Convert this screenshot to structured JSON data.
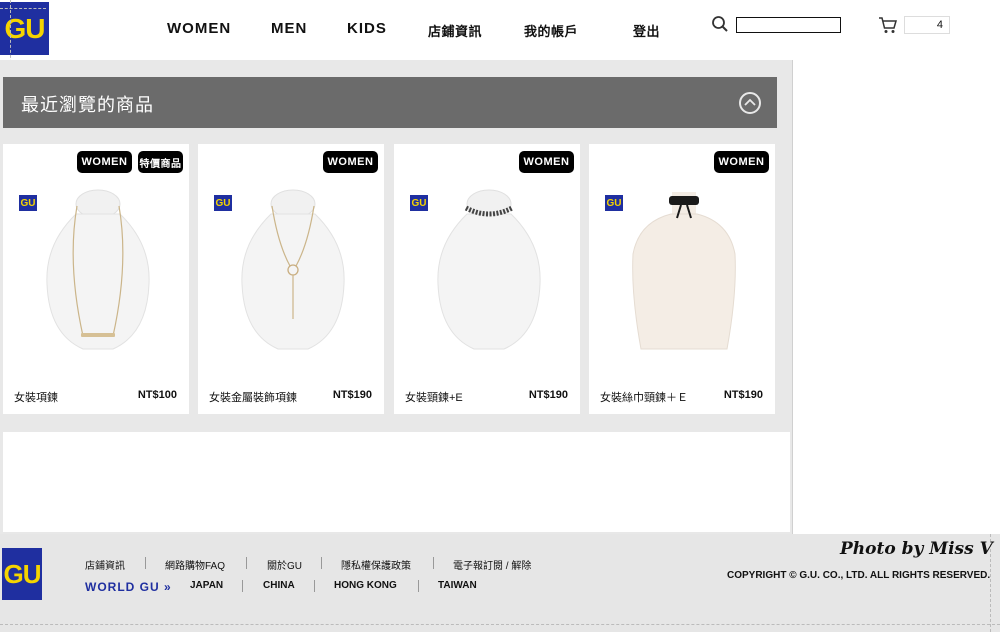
{
  "header": {
    "logo": "GU",
    "nav": [
      "WOMEN",
      "MEN",
      "KIDS",
      "店鋪資訊",
      "我的帳戶",
      "登出"
    ],
    "search": {
      "value": "",
      "placeholder": ""
    },
    "cart_count": "4"
  },
  "recent": {
    "title": "最近瀏覽的商品",
    "products": [
      {
        "badges": [
          "WOMEN",
          "特價商品"
        ],
        "brand": "GU",
        "name": "女裝項鍊",
        "price": "NT$100"
      },
      {
        "badges": [
          "WOMEN"
        ],
        "brand": "GU",
        "name": "女裝金屬裝飾項鍊",
        "price": "NT$190"
      },
      {
        "badges": [
          "WOMEN"
        ],
        "brand": "GU",
        "name": "女裝頸鍊+E",
        "price": "NT$190"
      },
      {
        "badges": [
          "WOMEN"
        ],
        "brand": "GU",
        "name": "女裝絲巾頸鍊＋Ｅ",
        "price": "NT$190"
      }
    ]
  },
  "footer": {
    "logo": "GU",
    "links": [
      "店鋪資訊",
      "網路購物FAQ",
      "關於GU",
      "隱私權保護政策",
      "電子報訂閱 / 解除"
    ],
    "world_label": "WORLD GU",
    "regions": [
      "JAPAN",
      "CHINA",
      "HONG KONG",
      "TAIWAN"
    ],
    "watermark": "Photo by Miss V",
    "copyright": "COPYRIGHT © G.U. CO., LTD. ALL RIGHTS RESERVED."
  },
  "colors": {
    "brand_blue": "#1f2fa0",
    "brand_yellow": "#f5d400",
    "bar_grey": "#6b6b6b"
  }
}
